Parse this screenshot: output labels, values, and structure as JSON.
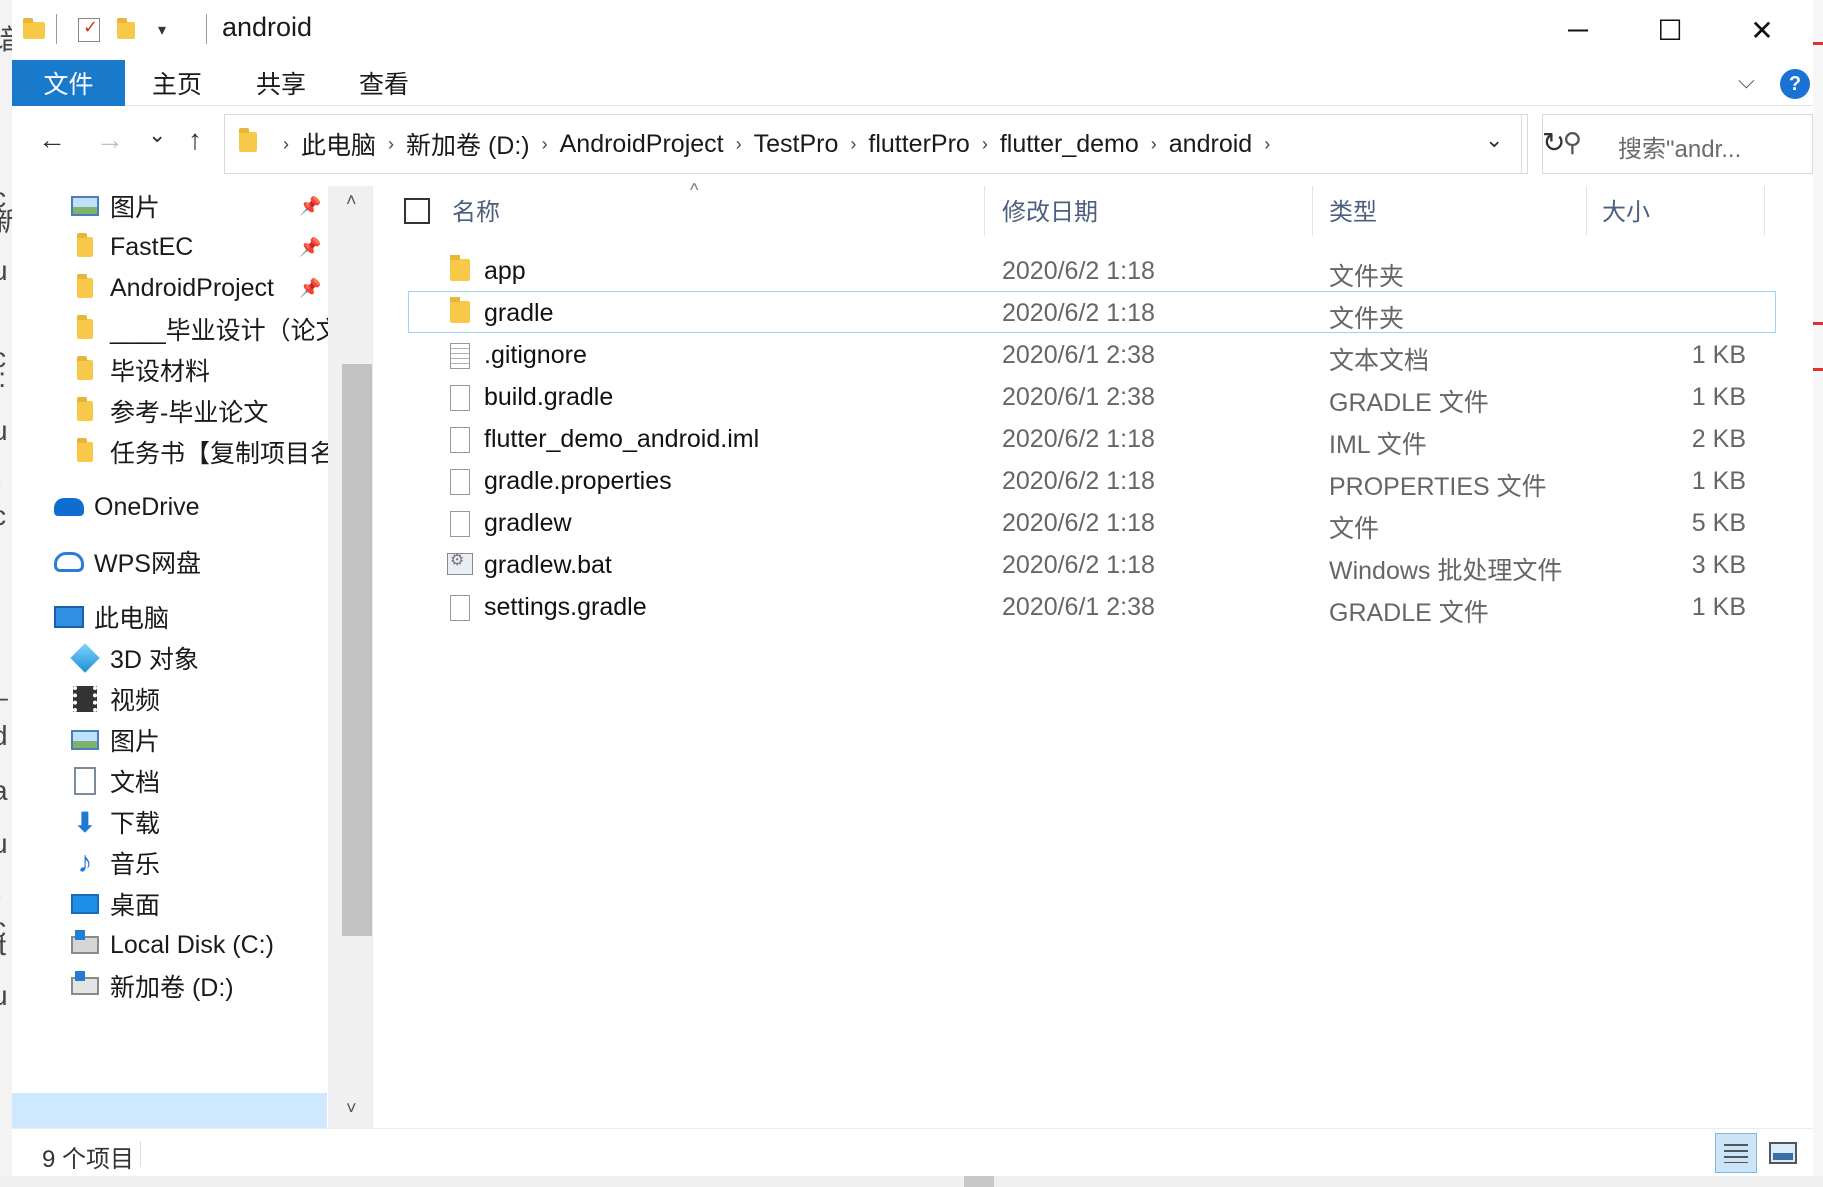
{
  "window": {
    "title": "android",
    "minimize_glyph": "─",
    "maximize_glyph": "☐",
    "close_glyph": "✕"
  },
  "quick_access": {
    "dropdown_glyph": "▾"
  },
  "ribbon": {
    "tabs": [
      "文件",
      "主页",
      "共享",
      "查看"
    ],
    "expand_glyph": "⌵",
    "help_glyph": "?"
  },
  "nav": {
    "back_glyph": "←",
    "forward_glyph": "→",
    "recent_glyph": "⌄",
    "up_glyph": "↑"
  },
  "address": {
    "crumbs": [
      "此电脑",
      "新加卷 (D:)",
      "AndroidProject",
      "TestPro",
      "flutterPro",
      "flutter_demo",
      "android"
    ],
    "separator": "›",
    "dropdown_glyph": "⌄",
    "refresh_glyph": "↻"
  },
  "search": {
    "icon_glyph": "⚲",
    "placeholder": "搜索\"andr..."
  },
  "nav_pane": {
    "items": [
      {
        "label": "图片",
        "icon": "pictures-icon",
        "pinned": true
      },
      {
        "label": "FastEC",
        "icon": "folder-icon",
        "pinned": true
      },
      {
        "label": "AndroidProject",
        "icon": "folder-icon",
        "pinned": true
      },
      {
        "label": "____毕业设计（论文",
        "icon": "folder-icon",
        "pinned": false
      },
      {
        "label": "毕设材料",
        "icon": "folder-icon",
        "pinned": false
      },
      {
        "label": "参考-毕业论文",
        "icon": "folder-icon",
        "pinned": false
      },
      {
        "label": "任务书【复制项目名",
        "icon": "folder-icon",
        "pinned": false
      },
      {
        "label": "OneDrive",
        "icon": "onedrive-icon"
      },
      {
        "label": "WPS网盘",
        "icon": "wps-cloud-icon"
      },
      {
        "label": "此电脑",
        "icon": "this-pc-icon"
      },
      {
        "label": "3D 对象",
        "icon": "3d-objects-icon"
      },
      {
        "label": "视频",
        "icon": "videos-icon"
      },
      {
        "label": "图片",
        "icon": "pictures-icon"
      },
      {
        "label": "文档",
        "icon": "documents-icon"
      },
      {
        "label": "下载",
        "icon": "downloads-icon"
      },
      {
        "label": "音乐",
        "icon": "music-icon"
      },
      {
        "label": "桌面",
        "icon": "desktop-icon"
      },
      {
        "label": "Local Disk (C:)",
        "icon": "local-disk-icon"
      },
      {
        "label": "新加卷 (D:)",
        "icon": "drive-icon",
        "selected": true
      }
    ],
    "pin_glyph": "📌",
    "scroll_up_glyph": "˄",
    "scroll_down_glyph": "˅",
    "download_glyph": "⬇",
    "music_glyph": "♪"
  },
  "columns": {
    "name": "名称",
    "date": "修改日期",
    "type": "类型",
    "size": "大小",
    "sort_glyph": "^"
  },
  "files": [
    {
      "name": "app",
      "date": "2020/6/2 1:18",
      "type": "文件夹",
      "size": "",
      "icon": "folder-icon"
    },
    {
      "name": "gradle",
      "date": "2020/6/2 1:18",
      "type": "文件夹",
      "size": "",
      "icon": "folder-icon",
      "selected": true
    },
    {
      "name": ".gitignore",
      "date": "2020/6/1 2:38",
      "type": "文本文档",
      "size": "1 KB",
      "icon": "text-file-icon"
    },
    {
      "name": "build.gradle",
      "date": "2020/6/1 2:38",
      "type": "GRADLE 文件",
      "size": "1 KB",
      "icon": "file-icon"
    },
    {
      "name": "flutter_demo_android.iml",
      "date": "2020/6/2 1:18",
      "type": "IML 文件",
      "size": "2 KB",
      "icon": "file-icon"
    },
    {
      "name": "gradle.properties",
      "date": "2020/6/2 1:18",
      "type": "PROPERTIES 文件",
      "size": "1 KB",
      "icon": "file-icon"
    },
    {
      "name": "gradlew",
      "date": "2020/6/2 1:18",
      "type": "文件",
      "size": "5 KB",
      "icon": "file-icon"
    },
    {
      "name": "gradlew.bat",
      "date": "2020/6/2 1:18",
      "type": "Windows 批处理文件",
      "size": "3 KB",
      "icon": "batch-file-icon"
    },
    {
      "name": "settings.gradle",
      "date": "2020/6/1 2:38",
      "type": "GRADLE 文件",
      "size": "1 KB",
      "icon": "file-icon"
    }
  ],
  "status": {
    "item_count": "9 个项目"
  },
  "colors": {
    "accent": "#1979ca",
    "selection_border": "#99d1ff",
    "nav_selected": "#cde8ff",
    "header_text": "#4b5f7f"
  }
}
